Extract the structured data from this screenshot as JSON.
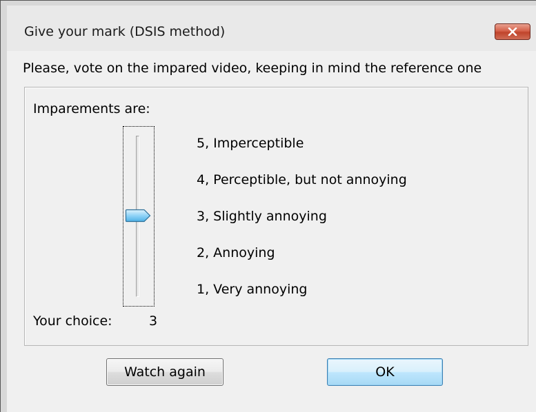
{
  "window": {
    "title": "Give your mark (DSIS method)",
    "close_label": "close"
  },
  "instruction": "Please, vote on the impared video, keeping in mind the reference one",
  "rating_group": {
    "caption": "Imparements are:",
    "scale": [
      {
        "value": 5,
        "label": "5, Imperceptible"
      },
      {
        "value": 4,
        "label": "4, Perceptible, but not annoying"
      },
      {
        "value": 3,
        "label": "3, Slightly annoying"
      },
      {
        "value": 2,
        "label": "2, Annoying"
      },
      {
        "value": 1,
        "label": "1, Very annoying"
      }
    ],
    "slider": {
      "min": 1,
      "max": 5,
      "value": 3
    },
    "choice_label": "Your choice:",
    "choice_value": "3"
  },
  "buttons": {
    "watch_again": "Watch again",
    "ok": "OK"
  },
  "colors": {
    "dialog_bg": "#f0f0f0",
    "close_button": "#c7432b",
    "ok_button_border": "#3c7fb1",
    "slider_thumb": "#6fc3f0"
  },
  "icons": {
    "close": "close-icon",
    "slider_thumb": "slider-thumb"
  }
}
